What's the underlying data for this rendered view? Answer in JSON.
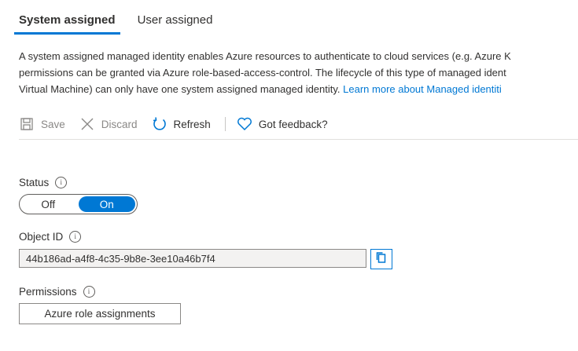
{
  "tabs": [
    {
      "label": "System assigned"
    },
    {
      "label": "User assigned"
    }
  ],
  "description": {
    "line1": "A system assigned managed identity enables Azure resources to authenticate to cloud services (e.g. Azure K",
    "line2": "permissions can be granted via Azure role-based-access-control. The lifecycle of this type of managed ident",
    "line3": "Virtual Machine) can only have one system assigned managed identity.",
    "link": "Learn more about Managed identiti"
  },
  "toolbar": {
    "save": "Save",
    "discard": "Discard",
    "refresh": "Refresh",
    "feedback": "Got feedback?"
  },
  "status": {
    "label": "Status",
    "off": "Off",
    "on": "On",
    "selected": "On"
  },
  "object_id": {
    "label": "Object ID",
    "value": "44b186ad-a4f8-4c35-9b8e-3ee10a46b7f4"
  },
  "permissions": {
    "label": "Permissions",
    "button": "Azure role assignments"
  },
  "colors": {
    "accent": "#0078d4",
    "text": "#323130",
    "disabled": "#8a8886"
  }
}
